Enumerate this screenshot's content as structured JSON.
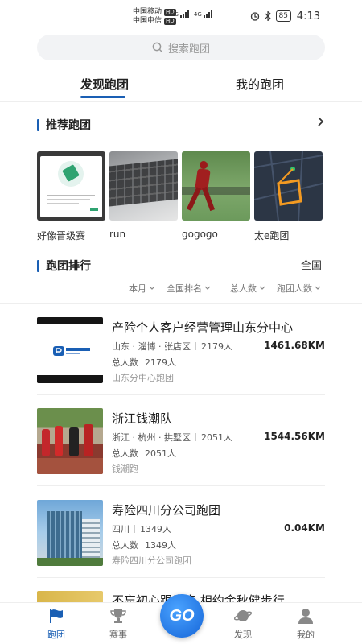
{
  "status": {
    "carrier1": "中国移动",
    "carrier2": "中国电信",
    "hd": "HD",
    "net1": "4G",
    "net2": "4G",
    "battery": "85",
    "time": "4:13"
  },
  "search": {
    "placeholder": "搜索跑团"
  },
  "tabs": [
    {
      "label": "发现跑团",
      "active": true
    },
    {
      "label": "我的跑团",
      "active": false
    }
  ],
  "recommended": {
    "title": "推荐跑团",
    "items": [
      {
        "label": "好像晋级赛"
      },
      {
        "label": "run"
      },
      {
        "label": "gogogo"
      },
      {
        "label": "太e跑团"
      }
    ]
  },
  "ranking": {
    "title": "跑团排行",
    "region": "全国",
    "filters": [
      "本月",
      "全国排名",
      "总人数",
      "跑团人数"
    ],
    "clubs": [
      {
        "name": "产险个人客户经营管理山东分中心",
        "province": "山东",
        "location": "山东 · 淄博 · 张店区",
        "members": "2179人",
        "total_label": "总人数",
        "total_value": "2179人",
        "distance": "1461.68KM",
        "sub": "山东分中心跑团"
      },
      {
        "name": "浙江钱潮队",
        "location": "浙江 · 杭州 · 拱墅区",
        "members": "2051人",
        "total_label": "总人数",
        "total_value": "2051人",
        "distance": "1544.56KM",
        "sub": "钱潮跑"
      },
      {
        "name": "寿险四川分公司跑团",
        "location": "四川",
        "members": "1349人",
        "total_label": "总人数",
        "total_value": "1349人",
        "distance": "0.04KM",
        "sub": "寿险四川分公司跑团"
      },
      {
        "name": "不忘初心跟党走 相约金秋健步行"
      }
    ]
  },
  "nav": {
    "items": [
      {
        "label": "跑团",
        "icon": "flag-icon",
        "active": true
      },
      {
        "label": "赛事",
        "icon": "trophy-icon",
        "active": false
      },
      {
        "label": "发现",
        "icon": "planet-icon",
        "active": false
      },
      {
        "label": "我的",
        "icon": "person-icon",
        "active": false
      }
    ],
    "go_label": "GO"
  },
  "colors": {
    "accent": "#1a5fb4",
    "muted": "#999999"
  }
}
